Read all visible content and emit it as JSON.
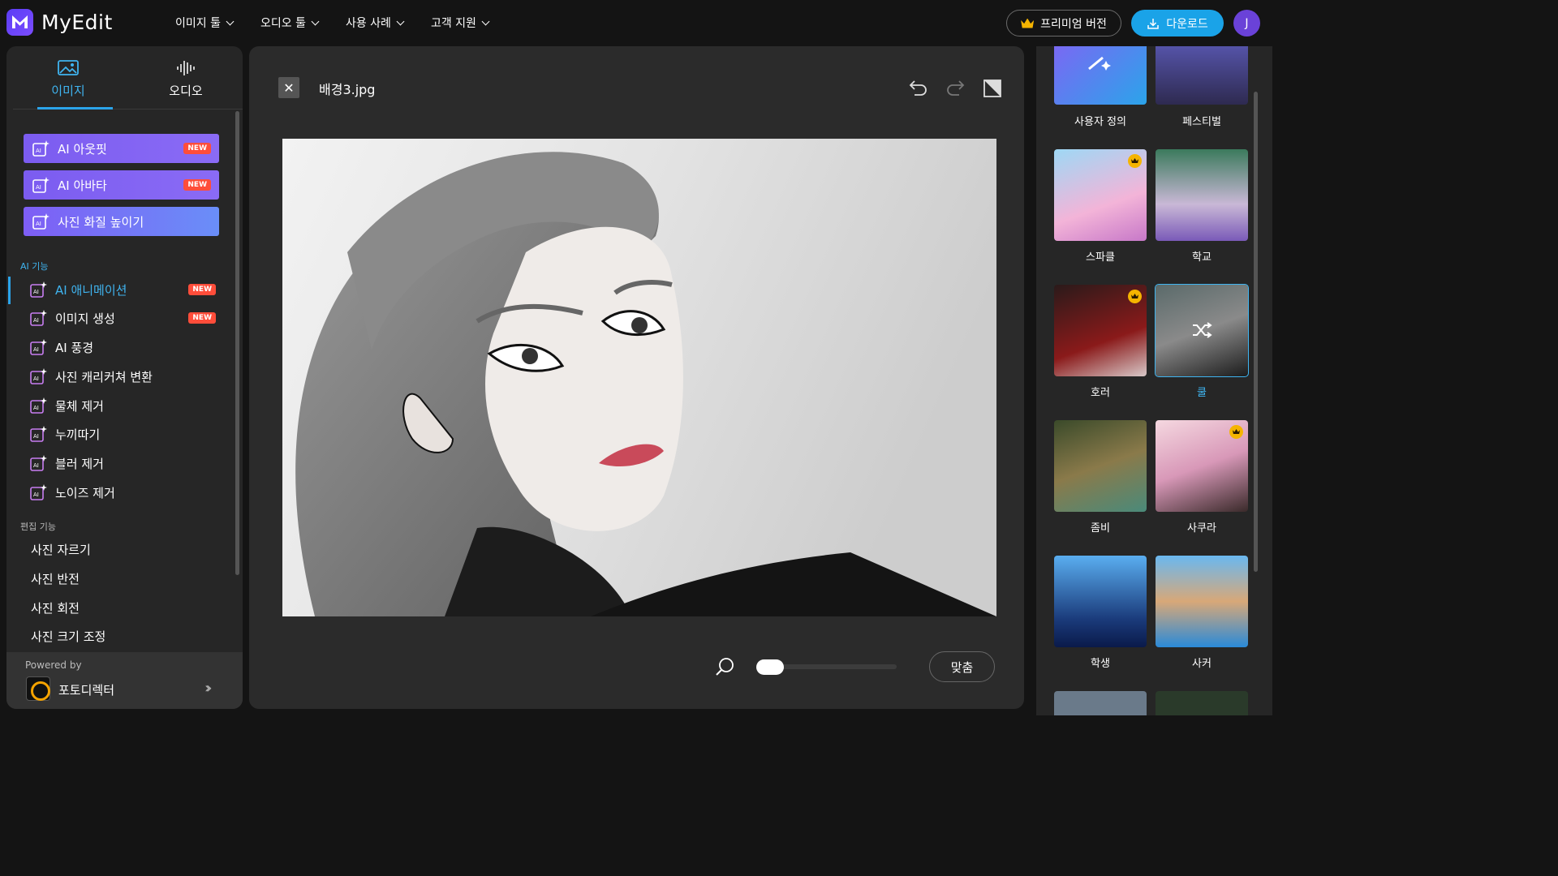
{
  "app": {
    "name": "MyEdit"
  },
  "topnav": [
    {
      "label": "이미지 툴"
    },
    {
      "label": "오디오 툴"
    },
    {
      "label": "사용 사례"
    },
    {
      "label": "고객 지원"
    }
  ],
  "header": {
    "premium_label": "프리미엄 버전",
    "download_label": "다운로드",
    "avatar_initial": "J"
  },
  "sidebar": {
    "tabs": [
      {
        "label": "이미지"
      },
      {
        "label": "오디오"
      }
    ],
    "promos": [
      {
        "label": "AI 아웃핏",
        "badge": "NEW"
      },
      {
        "label": "AI 아바타",
        "badge": "NEW"
      },
      {
        "label": "사진 화질 높이기"
      }
    ],
    "ai_section_label": "AI 기능",
    "ai_items": [
      {
        "label": "AI 애니메이션",
        "badge": "NEW"
      },
      {
        "label": "이미지 생성",
        "badge": "NEW"
      },
      {
        "label": "AI 풍경"
      },
      {
        "label": "사진 캐리커쳐 변환"
      },
      {
        "label": "물체 제거"
      },
      {
        "label": "누끼따기"
      },
      {
        "label": "블러 제거"
      },
      {
        "label": "노이즈 제거"
      }
    ],
    "edit_section_label": "편집 기능",
    "edit_items": [
      {
        "label": "사진 자르기"
      },
      {
        "label": "사진 반전"
      },
      {
        "label": "사진 회전"
      },
      {
        "label": "사진 크기 조정"
      }
    ],
    "powered_by": "Powered by",
    "powered_product": "포토디렉터"
  },
  "editor": {
    "filename": "배경3.jpg",
    "fit_label": "맞춤",
    "zoom_level": 0.05
  },
  "styles": [
    {
      "label": "사용자 정의"
    },
    {
      "label": "페스티벌"
    },
    {
      "label": "스파클",
      "premium": true
    },
    {
      "label": "학교"
    },
    {
      "label": "호러",
      "premium": true
    },
    {
      "label": "쿨",
      "selected": true
    },
    {
      "label": "좀비"
    },
    {
      "label": "사쿠라",
      "premium": true
    },
    {
      "label": "학생"
    },
    {
      "label": "사커"
    }
  ],
  "colors": {
    "accent": "#2ba4ea",
    "new_badge": "#ff4d3a",
    "premium": "#f5b400",
    "promo": "#7b5cf0"
  }
}
